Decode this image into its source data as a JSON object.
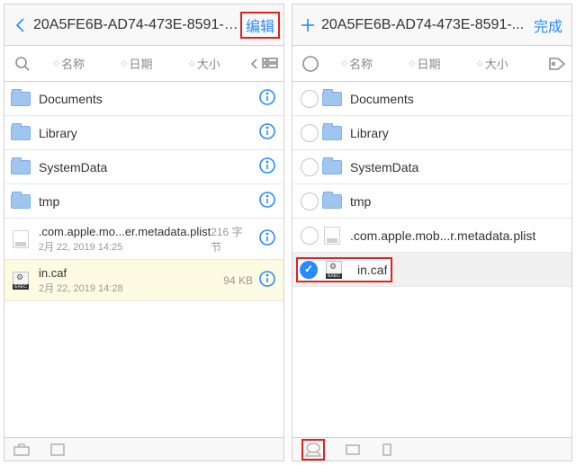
{
  "left": {
    "title": "20A5FE6B-AD74-473E-8591-D7...",
    "action": "编辑",
    "sort": {
      "name": "名称",
      "date": "日期",
      "size": "大小"
    },
    "folders": [
      "Documents",
      "Library",
      "SystemData",
      "tmp"
    ],
    "plist": {
      "name": ".com.apple.mo...er.metadata.plist",
      "meta": "2月 22, 2019 14:25",
      "size": "216 字节"
    },
    "sel": {
      "name": "in.caf",
      "meta": "2月 22, 2019 14:28",
      "size": "94 KB"
    }
  },
  "right": {
    "title": "20A5FE6B-AD74-473E-8591-...",
    "action": "完成",
    "sort": {
      "name": "名称",
      "date": "日期",
      "size": "大小"
    },
    "folders": [
      "Documents",
      "Library",
      "SystemData",
      "tmp"
    ],
    "plist": {
      "name": ".com.apple.mob...r.metadata.plist"
    },
    "sel": {
      "name": "in.caf"
    }
  }
}
